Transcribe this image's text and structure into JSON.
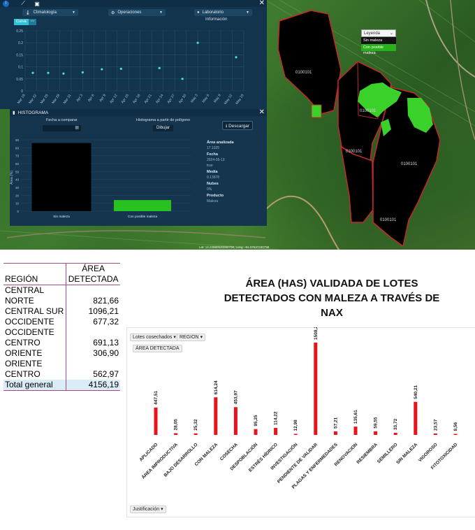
{
  "app": {
    "topbar_icons": [
      "info-icon",
      "satellite-icon",
      "camera-icon"
    ],
    "close_glyph": "✕"
  },
  "toolbar": {
    "climatologia": "Climatología",
    "operaciones": "Operaciones",
    "laboratorio": "Laboratorio",
    "informacion": "Información"
  },
  "curve_toggle": {
    "label": "Curva",
    "alt": "📈"
  },
  "index_chart": {
    "type": "scatter",
    "y_ticks": [
      "0.25",
      "0.2",
      "0.15",
      "0.1",
      "0.05",
      "0"
    ],
    "ylim": [
      0,
      0.25
    ],
    "x": [
      "Mar 19",
      "Mar 22",
      "Mar 25",
      "Mar 28",
      "Mar 31",
      "Apr 3",
      "Apr 6",
      "Apr 9",
      "Apr 12",
      "Apr 15",
      "Apr 18",
      "Apr 21",
      "Apr 24",
      "Apr 27",
      "Apr 30",
      "May 3",
      "May 6",
      "May 9",
      "May 12",
      "May 15"
    ],
    "points": [
      {
        "x": "Mar 21",
        "y": 0.075
      },
      {
        "x": "Mar 25",
        "y": 0.075
      },
      {
        "x": "Mar 29",
        "y": 0.072
      },
      {
        "x": "Apr 3",
        "y": 0.077
      },
      {
        "x": "Apr 8",
        "y": 0.09
      },
      {
        "x": "Apr 13",
        "y": 0.092
      },
      {
        "x": "Apr 23",
        "y": 0.095
      },
      {
        "x": "Apr 29",
        "y": 0.05
      },
      {
        "x": "May 3",
        "y": 0.2
      },
      {
        "x": "May 13",
        "y": 0.14
      }
    ]
  },
  "histogram_panel": {
    "title": "HISTOGRAMA",
    "compare_label": "Fecha a comparar",
    "polygon_label": "Histograma a partir de polígono",
    "draw_button": "Dibujar",
    "download_button": "Descargar",
    "y_axis_label": "Área (%)",
    "y_ticks": [
      "90",
      "80",
      "70",
      "60",
      "50",
      "40",
      "30",
      "20",
      "10",
      "0"
    ],
    "categories": [
      "Sin maleza",
      "Con posible maleza"
    ],
    "values": [
      86,
      14
    ],
    "bar_colors": [
      "#000000",
      "#27c21f"
    ],
    "stats": [
      {
        "label": "Área analizada",
        "value": "17.1025"
      },
      {
        "label": "Fecha",
        "value": "2024-05-13"
      },
      {
        "label": "",
        "value": "true"
      },
      {
        "label": "Media",
        "value": "0.13978"
      },
      {
        "label": "Nubes",
        "value": "0%"
      },
      {
        "label": "Producto",
        "value": "Maleza"
      }
    ]
  },
  "map": {
    "legend_title": "Leyenda",
    "legend_items": [
      "Sin maleza",
      "Con posible maleza"
    ],
    "lot_labels": [
      "0100101",
      "0100101",
      "0100101",
      "0100101",
      "0100101"
    ],
    "coordinates": "Lat: 14.22880530090708, Long: -91.07637230798"
  },
  "region_table": {
    "header_col1": "REGIÓN",
    "header_col2_line1": "ÁREA",
    "header_col2_line2": "DETECTADA",
    "rows": [
      {
        "region": [
          "CENTRAL",
          "NORTE"
        ],
        "value": "821,66"
      },
      {
        "region": [
          "CENTRAL SUR"
        ],
        "value": "1096,21"
      },
      {
        "region": [
          "OCCIDENTE"
        ],
        "value": "677,32"
      },
      {
        "region": [
          "OCCIDENTE",
          "CENTRO"
        ],
        "value": "691,13"
      },
      {
        "region": [
          "ORIENTE"
        ],
        "value": "306,90"
      },
      {
        "region": [
          "ORIENTE",
          "CENTRO"
        ],
        "value": "562,97"
      }
    ],
    "total_label": "Total general",
    "total_value": "4156,19"
  },
  "chart_data": {
    "type": "bar",
    "title": "ÁREA (HAS) VALIDADA DE LOTES DETECTADOS CON MALEZA A TRAVÉS DE NAX",
    "filters": [
      "Lotes cosechados",
      "REGION"
    ],
    "value_pill": "ÁREA DETECTADA",
    "axis_pill": "Justificación",
    "categories": [
      "APLICADO",
      "ÁREA IMPRODUCTIVA",
      "BAJO DESARROLLO",
      "CON MALEZA",
      "COSECHA",
      "DESPOBLACIÓN",
      "ESTRÉS HÍDRICO",
      "INVESTIGACIÓN",
      "PENDIENTE DE VALIDAR",
      "PLAGAS Y ENFERMEDADES",
      "RENOVACION",
      "RESIEMBRA",
      "SEMILLERO",
      "SIN MALEZA",
      "VIGOROSO",
      "FITOTOXICIDAD"
    ],
    "values": [
      447.51,
      28.05,
      25.32,
      614.24,
      453.97,
      95.25,
      114.22,
      12.98,
      1508.22,
      57.21,
      135.61,
      59.55,
      33.72,
      540.21,
      23.57,
      8.56
    ],
    "labels": [
      "447,51",
      "28,05",
      "25,32",
      "614,24",
      "453,97",
      "95,25",
      "114,22",
      "12,98",
      "1508,22",
      "57,21",
      "135,61",
      "59,55",
      "33,72",
      "540,21",
      "23,57",
      "8,56"
    ],
    "bar_color": "#e8141b",
    "ylim": [
      0,
      1508.22
    ],
    "grid": false
  }
}
